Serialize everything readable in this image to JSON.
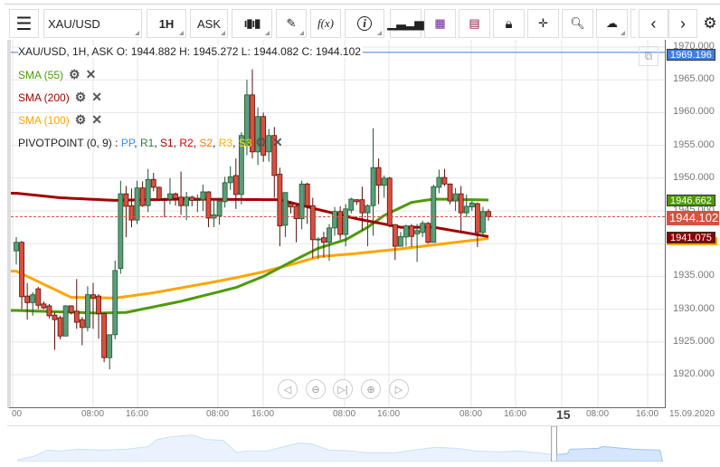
{
  "toolbar": {
    "symbol": "XAU/USD",
    "timeframe": "1H",
    "price_type": "ASK",
    "fx_label": "f(x)",
    "info_label": "i"
  },
  "header": {
    "ohlc_text": "XAU/USD, 1H, ASK  O: 1944.882 H: 1945.272 L: 1944.082 C: 1944.102"
  },
  "indicators": [
    {
      "label": "SMA (55)",
      "color": "#4e9a06"
    },
    {
      "label": "SMA (200)",
      "color": "#a40000"
    },
    {
      "label": "SMA (100)",
      "color": "#ffa500"
    }
  ],
  "pivot": {
    "label": "PIVOTPOINT (0, 9)",
    "sep": " : ",
    "items": [
      {
        "t": "PP",
        "c": "#3d8bfd"
      },
      {
        "t": "R1",
        "c": "#2e7d32"
      },
      {
        "t": "S1",
        "c": "#a40000"
      },
      {
        "t": "R2",
        "c": "#e00000"
      },
      {
        "t": "S2",
        "c": "#ff7f00"
      },
      {
        "t": "R3",
        "c": "#ffb300"
      },
      {
        "t": "S3",
        "c": "#ffe000"
      }
    ]
  },
  "price_labels": {
    "blue": "1969.196",
    "sma55": "1946.662",
    "last": "1944.102",
    "sma200": "1941.075"
  },
  "colors": {
    "up": "#5a9e78",
    "down": "#d9503f",
    "sma55": "#4e9a06",
    "sma100": "#ffa500",
    "sma200": "#a40000",
    "hline": "#3d7fe0",
    "last": "#d9503f"
  },
  "chart_data": {
    "type": "candlestick",
    "symbol": "XAU/USD",
    "ylim": [
      1917,
      1971
    ],
    "y_ticks": [
      "1970.000",
      "1965.000",
      "1960.000",
      "1955.000",
      "1950.000",
      "1945.000",
      "1940.000",
      "1935.000",
      "1930.000",
      "1925.000",
      "1920.000"
    ],
    "x_ticks": [
      "00",
      "08:00",
      "16:00",
      "08:00",
      "16:00",
      "08:00",
      "16:00",
      "08:00",
      "16:00",
      "15",
      "08:00",
      "16:00",
      "15.09.2020"
    ],
    "hline": 1969.196,
    "last": 1944.102,
    "ohlc": [
      [
        1938.9,
        1941.0,
        1936.8,
        1940.2
      ],
      [
        1940.2,
        1940.4,
        1930.0,
        1931.9
      ],
      [
        1932.0,
        1934.0,
        1928.4,
        1931.0
      ],
      [
        1931.0,
        1932.6,
        1929.0,
        1932.2
      ],
      [
        1933.1,
        1933.4,
        1930.0,
        1930.6
      ],
      [
        1930.8,
        1931.2,
        1930.0,
        1930.2
      ],
      [
        1930.5,
        1930.8,
        1928.6,
        1929.0
      ],
      [
        1929.1,
        1929.5,
        1923.8,
        1928.4
      ],
      [
        1928.7,
        1929.0,
        1925.4,
        1925.9
      ],
      [
        1925.9,
        1930.6,
        1925.9,
        1930.5
      ],
      [
        1930.5,
        1930.6,
        1929.2,
        1929.5
      ],
      [
        1929.7,
        1934.6,
        1927.0,
        1928.0
      ],
      [
        1928.4,
        1928.8,
        1924.5,
        1927.2
      ],
      [
        1927.2,
        1933.5,
        1926.6,
        1932.2
      ],
      [
        1932.2,
        1934.0,
        1927.0,
        1931.7
      ],
      [
        1932.0,
        1932.3,
        1925.5,
        1929.3
      ],
      [
        1929.3,
        1929.5,
        1921.9,
        1922.6
      ],
      [
        1922.6,
        1926.1,
        1920.8,
        1926.1
      ],
      [
        1926.1,
        1937.4,
        1925.4,
        1935.9
      ],
      [
        1936.2,
        1949.6,
        1935.4,
        1947.6
      ],
      [
        1947.6,
        1948.8,
        1941.0,
        1945.7
      ],
      [
        1945.8,
        1948.4,
        1942.5,
        1943.6
      ],
      [
        1943.6,
        1949.6,
        1943.0,
        1948.5
      ],
      [
        1948.5,
        1949.5,
        1945.6,
        1945.8
      ],
      [
        1945.8,
        1951.4,
        1944.8,
        1949.8
      ],
      [
        1949.8,
        1950.8,
        1948.0,
        1948.6
      ],
      [
        1948.6,
        1948.7,
        1946.5,
        1946.8
      ],
      [
        1946.7,
        1947.0,
        1944.0,
        1946.6
      ],
      [
        1946.8,
        1950.0,
        1946.0,
        1947.6
      ],
      [
        1947.6,
        1947.8,
        1945.8,
        1946.9
      ],
      [
        1947.1,
        1951.0,
        1944.4,
        1945.8
      ],
      [
        1945.8,
        1947.9,
        1943.6,
        1947.1
      ],
      [
        1947.1,
        1947.3,
        1945.7,
        1946.6
      ],
      [
        1946.6,
        1947.5,
        1944.8,
        1946.7
      ],
      [
        1946.7,
        1949.0,
        1945.0,
        1947.9
      ],
      [
        1947.9,
        1948.0,
        1942.5,
        1943.9
      ],
      [
        1943.9,
        1946.8,
        1942.5,
        1944.4
      ],
      [
        1944.2,
        1947.0,
        1942.9,
        1946.5
      ],
      [
        1946.4,
        1950.2,
        1945.5,
        1949.3
      ],
      [
        1949.3,
        1951.8,
        1948.2,
        1950.2
      ],
      [
        1950.4,
        1953.0,
        1945.3,
        1947.5
      ],
      [
        1947.5,
        1957.0,
        1946.0,
        1956.5
      ],
      [
        1955.0,
        1965.0,
        1953.5,
        1962.7
      ],
      [
        1962.7,
        1966.6,
        1953.0,
        1954.0
      ],
      [
        1954.0,
        1960.8,
        1952.0,
        1959.4
      ],
      [
        1959.4,
        1960.0,
        1952.5,
        1953.5
      ],
      [
        1954.0,
        1957.5,
        1952.5,
        1956.5
      ],
      [
        1956.5,
        1957.8,
        1947.0,
        1950.4
      ],
      [
        1950.6,
        1951.6,
        1939.6,
        1942.7
      ],
      [
        1942.8,
        1947.8,
        1941.0,
        1947.8
      ],
      [
        1946.1,
        1946.5,
        1944.6,
        1945.6
      ],
      [
        1945.7,
        1946.0,
        1940.2,
        1943.8
      ],
      [
        1943.8,
        1949.6,
        1942.2,
        1949.1
      ],
      [
        1949.1,
        1949.3,
        1943.0,
        1945.8
      ],
      [
        1945.8,
        1947.0,
        1937.8,
        1940.6
      ],
      [
        1940.6,
        1941.0,
        1937.6,
        1940.7
      ],
      [
        1940.9,
        1941.8,
        1937.9,
        1940.2
      ],
      [
        1940.2,
        1943.0,
        1937.4,
        1942.4
      ],
      [
        1942.4,
        1945.6,
        1941.2,
        1944.9
      ],
      [
        1944.9,
        1945.7,
        1940.6,
        1941.4
      ],
      [
        1941.4,
        1946.0,
        1939.6,
        1945.3
      ],
      [
        1945.1,
        1947.0,
        1944.6,
        1946.8
      ],
      [
        1946.7,
        1946.8,
        1945.9,
        1946.4
      ],
      [
        1946.7,
        1948.7,
        1942.0,
        1944.7
      ],
      [
        1944.7,
        1946.0,
        1939.6,
        1945.8
      ],
      [
        1945.8,
        1957.6,
        1941.2,
        1951.6
      ],
      [
        1951.6,
        1953.0,
        1946.0,
        1948.9
      ],
      [
        1948.9,
        1950.4,
        1947.0,
        1950.0
      ],
      [
        1950.0,
        1950.2,
        1942.5,
        1942.8
      ],
      [
        1942.9,
        1943.0,
        1937.5,
        1939.6
      ],
      [
        1939.6,
        1941.8,
        1939.6,
        1941.1
      ],
      [
        1941.0,
        1942.9,
        1939.6,
        1942.7
      ],
      [
        1942.7,
        1943.0,
        1939.5,
        1941.1
      ],
      [
        1941.5,
        1943.0,
        1937.2,
        1942.0
      ],
      [
        1941.7,
        1943.5,
        1941.0,
        1943.1
      ],
      [
        1943.1,
        1943.3,
        1940.0,
        1940.2
      ],
      [
        1940.2,
        1949.0,
        1940.2,
        1948.7
      ],
      [
        1948.6,
        1951.3,
        1947.7,
        1950.1
      ],
      [
        1950.1,
        1951.4,
        1948.8,
        1949.1
      ],
      [
        1949.1,
        1949.2,
        1946.0,
        1946.5
      ],
      [
        1946.5,
        1948.5,
        1945.0,
        1947.6
      ],
      [
        1947.6,
        1948.8,
        1941.6,
        1944.7
      ],
      [
        1944.7,
        1947.5,
        1944.0,
        1945.7
      ],
      [
        1945.6,
        1946.5,
        1945.0,
        1946.2
      ],
      [
        1946.1,
        1946.3,
        1939.5,
        1941.7
      ],
      [
        1941.7,
        1945.6,
        1941.0,
        1944.9
      ],
      [
        1944.9,
        1945.3,
        1943.5,
        1944.1
      ]
    ],
    "sma55": [
      [
        0,
        1929.8
      ],
      [
        15,
        1929.4
      ],
      [
        20,
        1929.5
      ],
      [
        30,
        1931.2
      ],
      [
        40,
        1933.3
      ],
      [
        45,
        1935
      ],
      [
        50,
        1937.2
      ],
      [
        55,
        1939.3
      ],
      [
        60,
        1940.6
      ],
      [
        64,
        1942.5
      ],
      [
        67,
        1944.3
      ],
      [
        72,
        1946.3
      ],
      [
        76,
        1946.8
      ],
      [
        86,
        1946.66
      ]
    ],
    "sma100": [
      [
        0,
        1935.8
      ],
      [
        5,
        1933.8
      ],
      [
        10,
        1931.8
      ],
      [
        18,
        1931.7
      ],
      [
        25,
        1932.5
      ],
      [
        35,
        1934.0
      ],
      [
        40,
        1934.8
      ],
      [
        45,
        1935.7
      ],
      [
        50,
        1936.8
      ],
      [
        55,
        1938.0
      ],
      [
        62,
        1938.5
      ],
      [
        70,
        1939.2
      ],
      [
        76,
        1939.8
      ],
      [
        86,
        1940.8
      ]
    ],
    "sma200": [
      [
        0,
        1947.7
      ],
      [
        8,
        1947.0
      ],
      [
        18,
        1946.6
      ],
      [
        30,
        1946.8
      ],
      [
        48,
        1946.7
      ],
      [
        55,
        1945.2
      ],
      [
        62,
        1943.8
      ],
      [
        70,
        1942.5
      ],
      [
        76,
        1942.5
      ],
      [
        86,
        1941.075
      ]
    ]
  }
}
